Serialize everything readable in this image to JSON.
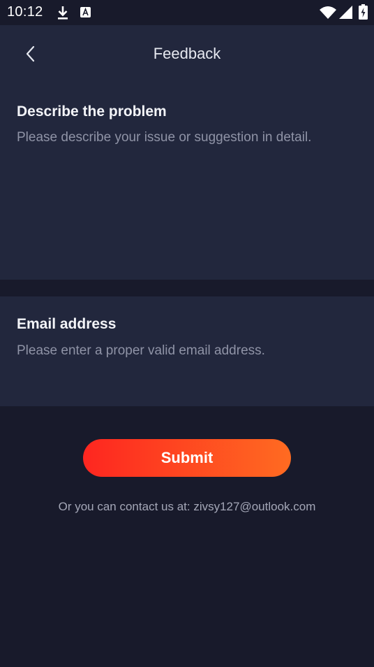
{
  "status_bar": {
    "time": "10:12",
    "icons": [
      "download-icon",
      "a-notification-icon",
      "wifi-icon",
      "signal-icon",
      "battery-icon"
    ]
  },
  "header": {
    "back_icon": "chevron-left-icon",
    "title": "Feedback"
  },
  "problem": {
    "heading": "Describe the problem",
    "placeholder": "Please describe your issue or suggestion in detail.",
    "value": ""
  },
  "email": {
    "heading": "Email address",
    "placeholder": "Please enter a proper valid email address.",
    "value": ""
  },
  "submit": {
    "label": "Submit"
  },
  "contact": {
    "text": "Or you can contact us at: zivsy127@outlook.com"
  },
  "colors": {
    "background": "#181a2b",
    "panel": "#22273d",
    "accent_start": "#fe2620",
    "accent_end": "#ff6b21",
    "placeholder": "#8f93a6"
  }
}
